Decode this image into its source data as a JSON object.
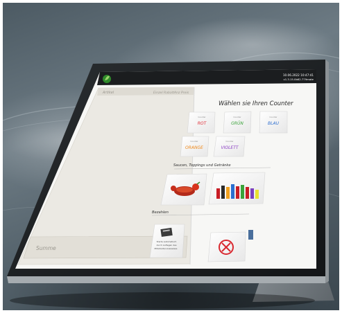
{
  "status": {
    "datetime": "10.06.2022 10:47:41",
    "version": "v1.3.15.0b62.779mate"
  },
  "cart": {
    "col_article": "Artikel",
    "col_single": "Einzel",
    "col_discount": "Rabatt",
    "col_count": "Anz",
    "col_price": "Preis",
    "sum_label": "Summe"
  },
  "counter": {
    "heading": "Wählen sie Ihren Counter",
    "tiles": [
      {
        "small": "Counter",
        "name": "ROT",
        "color": "#e0303a"
      },
      {
        "small": "Counter",
        "name": "GRÜN",
        "color": "#3aa23a"
      },
      {
        "small": "Counter",
        "name": "BLAU",
        "color": "#2f6fd0"
      },
      {
        "small": "Counter",
        "name": "ORANGE",
        "color": "#f08a1c"
      },
      {
        "small": "Counter",
        "name": "VIOLETT",
        "color": "#8b3fc4"
      }
    ]
  },
  "extras": {
    "heading": "Saucen, Toppings und Getränke"
  },
  "pay": {
    "heading": "Bezahlen",
    "card_text_1": "Starte automatisch",
    "card_text_2": "durch Auflegen des",
    "card_text_3": "Mitarbeiter-Ausweises"
  },
  "icons": {
    "logo": "leaf-logo-icon",
    "cancel": "cancel-x-icon",
    "card": "card-reader-icon"
  }
}
